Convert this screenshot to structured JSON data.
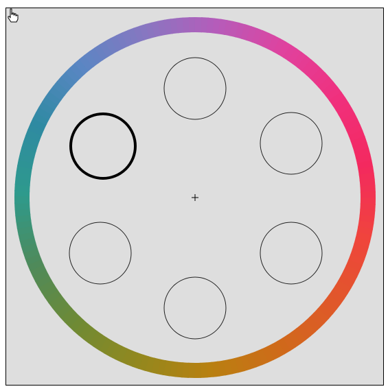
{
  "color_wheel": {
    "hue_stops": [
      "#2e9a8c",
      "#2f8aa2",
      "#5a86c3",
      "#8777c1",
      "#b55cba",
      "#e0429e",
      "#f0307d",
      "#f3295f",
      "#f0443d",
      "#e0582a",
      "#cf6a1a",
      "#b88010",
      "#93881e",
      "#6f8a34",
      "#4f8a5a",
      "#2e9a8c"
    ],
    "ring_width": 22
  },
  "swatches": [
    {
      "id": "top",
      "selected": false
    },
    {
      "id": "upper-right",
      "selected": false
    },
    {
      "id": "lower-right",
      "selected": false
    },
    {
      "id": "bottom",
      "selected": false
    },
    {
      "id": "lower-left",
      "selected": false
    },
    {
      "id": "upper-left",
      "selected": true
    }
  ],
  "center_marker": "crosshair-icon",
  "cursor": "hand-pointer-icon",
  "colors": {
    "background": "#dedede",
    "border": "#000000",
    "swatch_stroke": "#222222",
    "selected_stroke": "#000000"
  }
}
